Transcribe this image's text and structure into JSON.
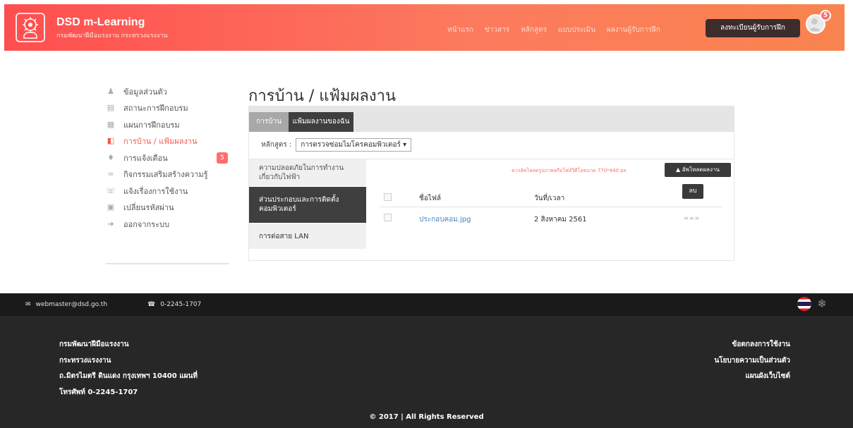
{
  "header": {
    "brand_title": "DSD m-Learning",
    "brand_subtitle": "กรมพัฒนาฝีมือแรงงาน กระทรวงแรงงาน",
    "nav": [
      "หน้าแรก",
      "ข่าวสาร",
      "หลักสูตร",
      "แบบประเมิน",
      "ผลงานผู้รับการฝึก"
    ],
    "register_label": "ลงทะเบียนผู้รับการฝึก",
    "notification_count": "5"
  },
  "sidebar": {
    "items": [
      {
        "label": "ข้อมูลส่วนตัว",
        "icon": "user-icon"
      },
      {
        "label": "สถานะการฝึกอบรม",
        "icon": "status-icon"
      },
      {
        "label": "แผนการฝึกอบรม",
        "icon": "calendar-icon"
      },
      {
        "label": "การบ้าน / แฟ้มผลงาน",
        "icon": "folder-icon",
        "active": true
      },
      {
        "label": "การแจ้งเตือน",
        "icon": "bell-icon",
        "badge": "5"
      },
      {
        "label": "กิจกรรมเสริมสร้างความรู้",
        "icon": "activity-icon"
      },
      {
        "label": "แจ้งเรื่องการใช้งาน",
        "icon": "phone-icon"
      },
      {
        "label": "เปลี่ยนรหัสผ่าน",
        "icon": "lock-icon"
      },
      {
        "label": "ออกจากระบบ",
        "icon": "logout-icon"
      }
    ]
  },
  "main": {
    "title": "การบ้าน / แฟ้มผลงาน",
    "tabs": [
      "การบ้าน",
      "แฟ้มผลงานของฉัน"
    ],
    "course_label": "หลักสูตร :",
    "course_value": "การตรวจซ่อมไมโครคอมพิวเตอร์ ▾",
    "subnav": [
      "ความปลอดภัยในการทำงานเกี่ยวกับไฟฟ้า",
      "ส่วนประกอบและการติดตั้งคอมพิวเตอร์",
      "การต่อสาย LAN"
    ],
    "upload_hint": "ควรอัพโหลดรูปภาพหรือไฟล์วีดีโอขนาด 770*440 px",
    "upload_label": "อัพโหลดผลงาน",
    "delete_label": "ลบ",
    "table": {
      "headers": [
        "ชื่อไฟล์",
        "วันที่/เวลา"
      ],
      "rows": [
        {
          "file": "ประกอบคอม.jpg",
          "date": "2 สิงหาคม 2561",
          "action": "≡≡≡"
        }
      ]
    }
  },
  "footer": {
    "email": "webmaster@dsd.go.th",
    "phone": "0-2245-1707",
    "org_lines": [
      "กรมพัฒนาฝีมือแรงงาน",
      "กระทรวงแรงงาน",
      "ถ.มิตรไมตรี ดินแดง กรุงเทพฯ 10400 แผนที่",
      "โทรศัพท์ 0-2245-1707"
    ],
    "links": [
      "ข้อตกลงการใช้งาน",
      "นโยบายความเป็นส่วนตัว",
      "แผนผังเว็บไซต์"
    ],
    "copyright": "© 2017 | All Rights Reserved"
  },
  "colors": {
    "accent": "#f05a4f",
    "header_gradient_start": "#ff4e50",
    "header_gradient_end": "#f9844f",
    "dark": "#272727"
  }
}
